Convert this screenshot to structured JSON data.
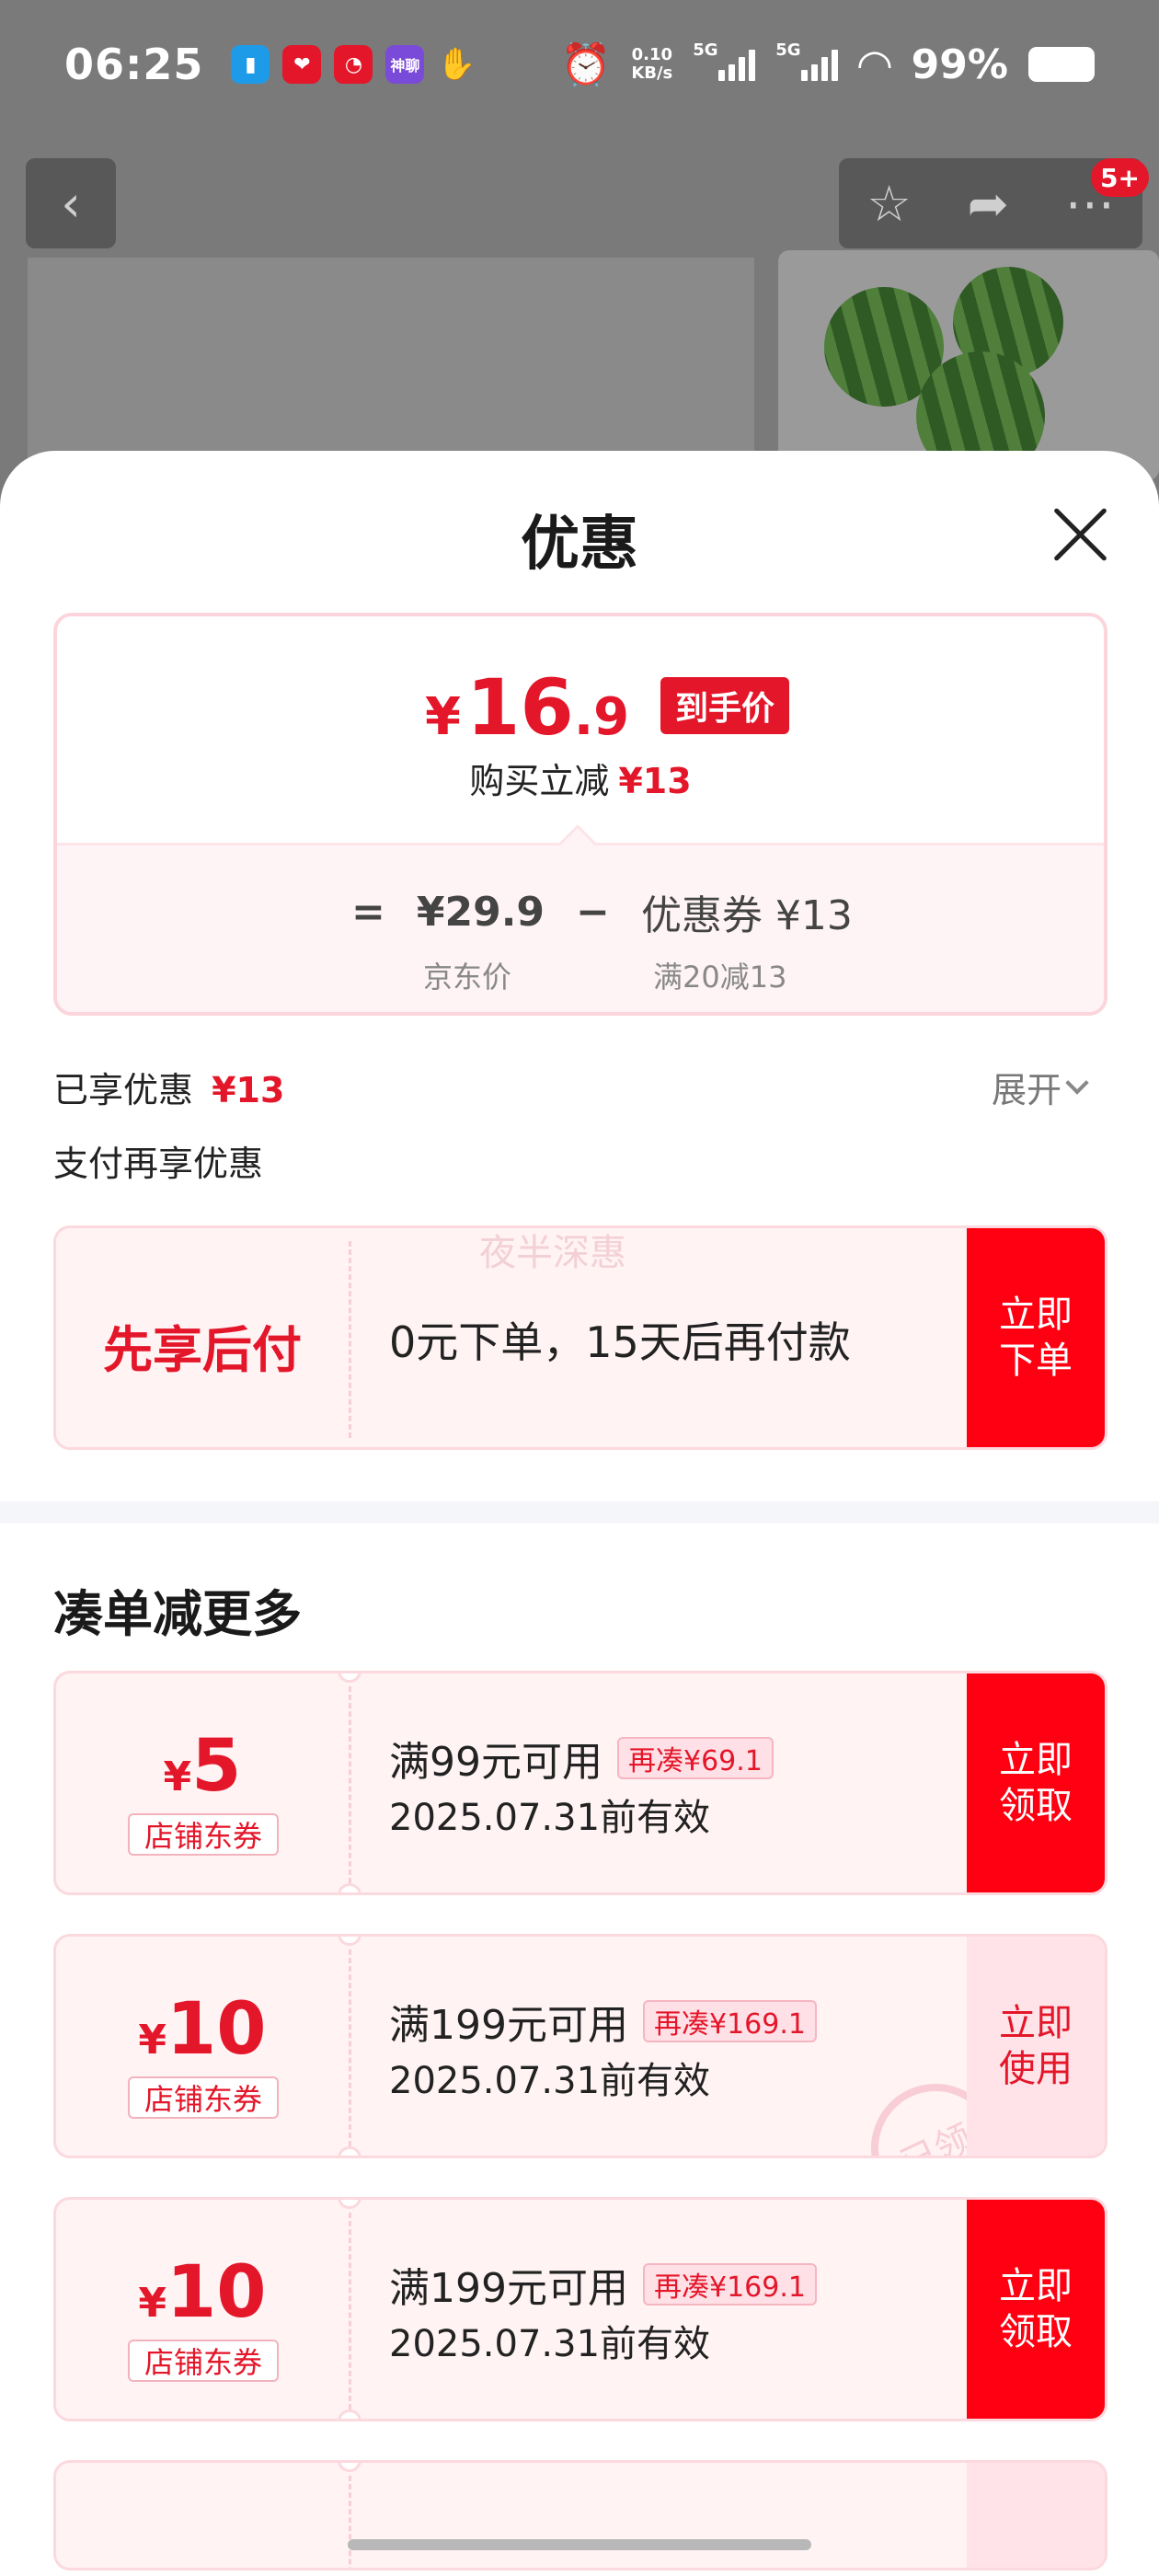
{
  "status_bar": {
    "time": "06:25",
    "net_speed_value": "0.10",
    "net_speed_unit": "KB/s",
    "signal_1": "5G",
    "signal_2": "5G",
    "battery": "99%",
    "app_icon_4_text": "神聊"
  },
  "nav": {
    "back_icon": "chevron-left-icon",
    "favorite_icon": "star-icon",
    "share_icon": "share-icon",
    "more_icon": "more-icon",
    "more_badge": "5+"
  },
  "sheet": {
    "title": "优惠",
    "price_card": {
      "currency": "¥",
      "final_int": "16",
      "final_dec": ".9",
      "final_tag": "到手价",
      "buy_save_label": "购买立减",
      "buy_save_amount": "¥13",
      "eq": "=",
      "jd_price": "¥29.9",
      "minus": "−",
      "coupon_label": "优惠券 ¥13",
      "jd_price_label": "京东价",
      "coupon_rule": "满20减13"
    },
    "enjoyed_label": "已享优惠",
    "enjoyed_amount": "¥13",
    "expand_label": "展开",
    "pay_more_label": "支付再享优惠",
    "bnpl": {
      "watermark": "夜半深惠",
      "label": "先享后付",
      "text": "0元下单，15天后再付款",
      "cta_line1": "立即",
      "cta_line2": "下单"
    },
    "more_section_title": "凑单减更多",
    "coupons": [
      {
        "currency": "¥",
        "amount": "5",
        "shop_tag": "店铺东券",
        "rule": "满99元可用",
        "more_tag": "再凑¥69.1",
        "validity": "2025.07.31前有效",
        "cta_line1": "立即",
        "cta_line2": "领取",
        "state": "available"
      },
      {
        "currency": "¥",
        "amount": "10",
        "shop_tag": "店铺东券",
        "rule": "满199元可用",
        "more_tag": "再凑¥169.1",
        "validity": "2025.07.31前有效",
        "cta_line1": "立即",
        "cta_line2": "使用",
        "state": "claimed",
        "stamp": "已领"
      },
      {
        "currency": "¥",
        "amount": "10",
        "shop_tag": "店铺东券",
        "rule": "满199元可用",
        "more_tag": "再凑¥169.1",
        "validity": "2025.07.31前有效",
        "cta_line1": "立即",
        "cta_line2": "领取",
        "state": "available"
      }
    ]
  },
  "colors": {
    "accent_red": "#e4162a",
    "cta_red": "#ff0012",
    "card_bg": "#fff3f4"
  }
}
